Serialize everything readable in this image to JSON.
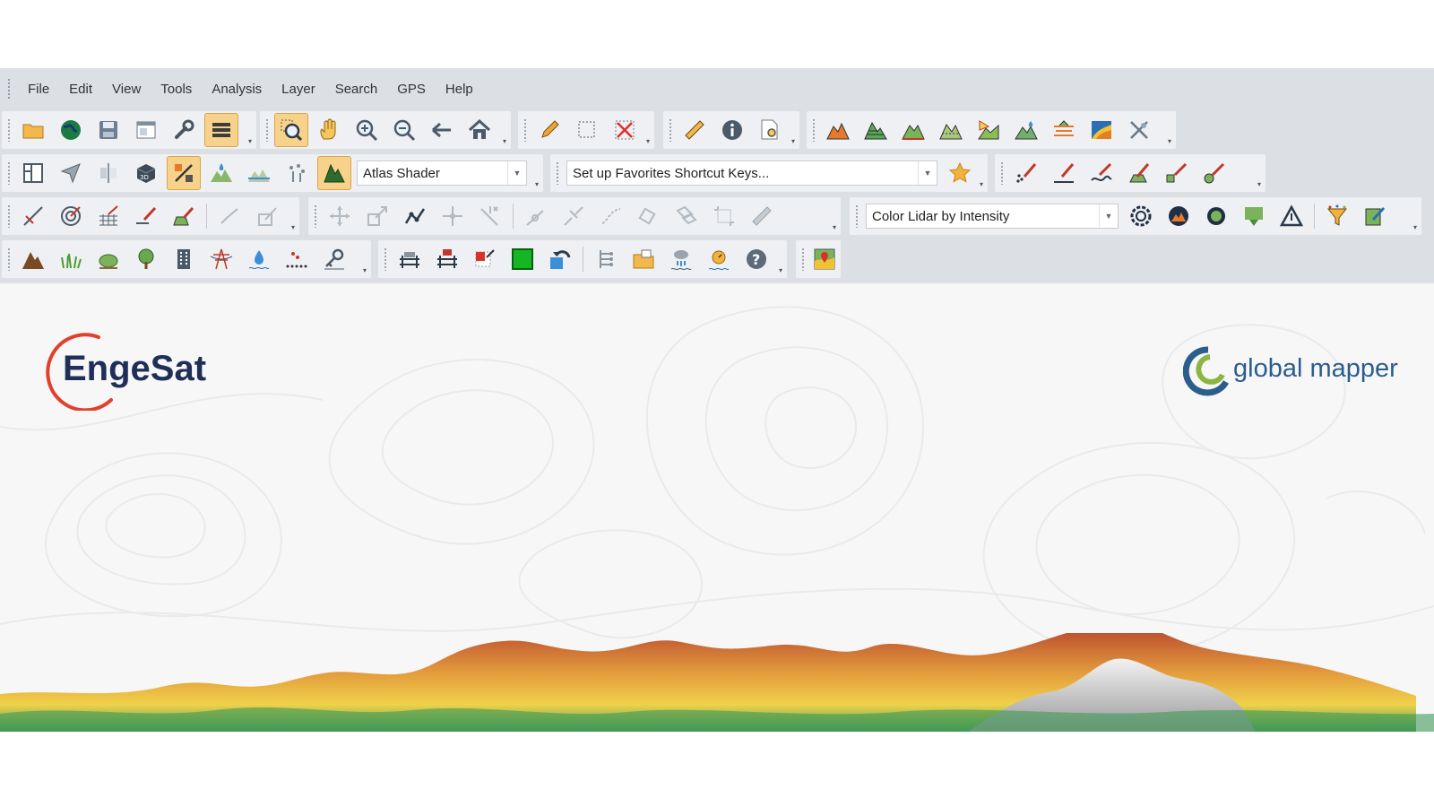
{
  "menu": [
    "File",
    "Edit",
    "View",
    "Tools",
    "Analysis",
    "Layer",
    "Search",
    "GPS",
    "Help"
  ],
  "toolbars": {
    "row1": {
      "file_tools": [
        "open-folder-icon",
        "globe-icon",
        "save-icon",
        "window-icon",
        "wrench-icon",
        "layers-icon"
      ],
      "nav_tools": [
        "zoom-box-icon",
        "pan-hand-icon",
        "zoom-in-icon",
        "zoom-out-icon",
        "back-arrow-icon",
        "home-icon"
      ],
      "edit_tools": [
        "pencil-icon",
        "select-rectangle-icon",
        "delete-x-icon"
      ],
      "info_tools": [
        "ruler-icon",
        "info-icon",
        "search-doc-icon"
      ],
      "terrain_tools": [
        "terrain-orange-icon",
        "terrain-green-icon",
        "terrain-flat-icon",
        "terrain-profile-icon",
        "view-shed-icon",
        "watershed-icon",
        "contour-icon",
        "raster-map-icon",
        "digitize-icon"
      ]
    },
    "row2": {
      "shader_tools": [
        "map-layout-icon",
        "direction-icon",
        "split-icon",
        "3d-view-icon",
        "percent-icon",
        "water-drop-icon",
        "water-level-icon",
        "lidar-classify-icon",
        "shader-icon"
      ],
      "shader_select": {
        "value": "Atlas Shader"
      },
      "favorites_select": {
        "value": "Set up Favorites Shortcut Keys..."
      },
      "favorites_icon": "star-icon",
      "draw_tools": [
        "draw-points-icon",
        "draw-line-icon",
        "draw-curve-icon",
        "draw-area-icon",
        "draw-brush-icon",
        "draw-circle-icon"
      ]
    },
    "row3": {
      "measure_tools": [
        "measure-icon",
        "target-icon",
        "grid-measure-icon",
        "cut-line-icon",
        "area-edit-icon",
        "check-line-icon",
        "edit-form-icon"
      ],
      "vertex_tools": [
        "move-icon",
        "scale-icon",
        "reshape-icon",
        "move-vertex-icon",
        "delete-vertex-icon",
        "add-point-icon",
        "split-line-icon",
        "smooth-icon",
        "rotate-icon",
        "copy-icon",
        "crop-icon",
        "ruler-pencil-icon"
      ],
      "lidar_select": {
        "value": "Color Lidar by Intensity"
      },
      "lidar_tools": [
        "lidar-settings-icon",
        "lidar-terrain-icon",
        "lidar-gear-icon",
        "lidar-filter-icon",
        "triangle-icon",
        "funnel-icon",
        "edit-note-icon"
      ]
    },
    "row4": {
      "classify_tools": [
        "ground-icon",
        "grass-icon",
        "bush-icon",
        "tree-icon",
        "building-icon",
        "power-line-icon",
        "water-icon",
        "noise-icon",
        "key-icon"
      ],
      "object_tools": [
        "bridge-icon",
        "bridge-id-icon",
        "resize-red-icon",
        "green-square-icon",
        "undo-blue-icon",
        "tree-diagram-icon",
        "folder-open-icon",
        "weather-icon",
        "sun-icon",
        "help-icon"
      ],
      "map_tools": [
        "map-pin-icon"
      ]
    }
  },
  "branding": {
    "engesat": "EngeSat",
    "global_mapper": "global mapper"
  },
  "colors": {
    "chrome": "#dcdfe4",
    "toolbar": "#eef0f3",
    "engesat_red": "#e2402a",
    "engesat_navy": "#1f2f57",
    "gm_blue": "#2b5d8d",
    "gm_green": "#8db543"
  }
}
